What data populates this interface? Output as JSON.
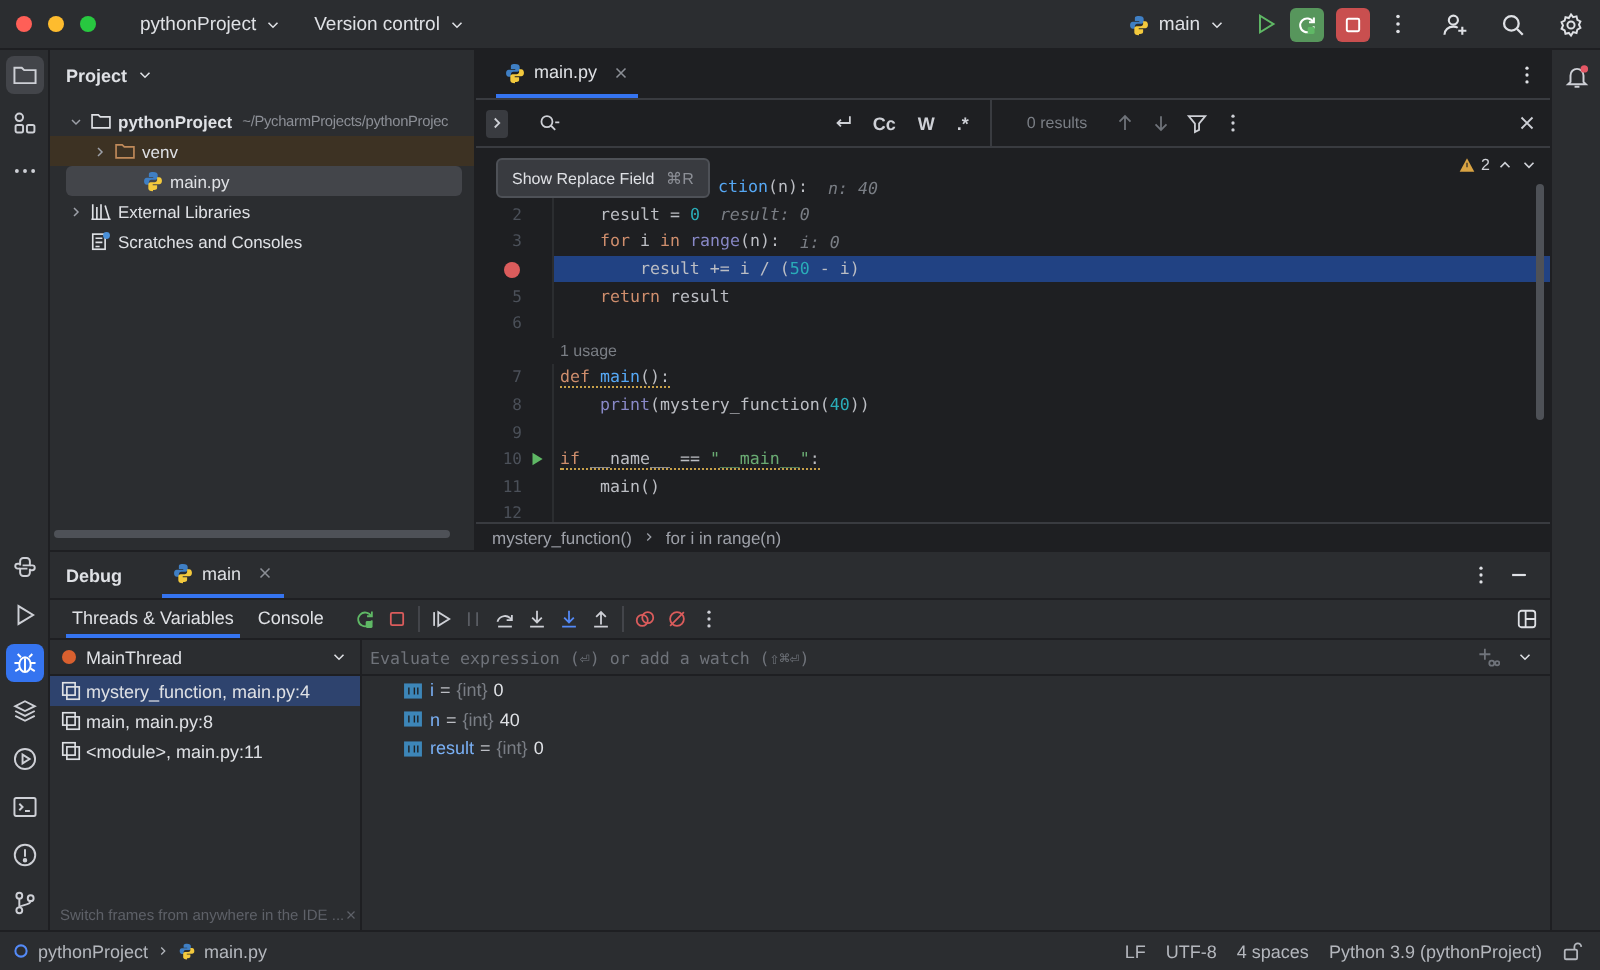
{
  "titlebar": {
    "project": "pythonProject",
    "vcs": "Version control",
    "run_config": "main"
  },
  "toolstrip": {
    "top": [
      {
        "selected": true
      },
      {
        "selected": false
      },
      {
        "selected": false
      }
    ],
    "bottom": [
      {
        "selected": false
      },
      {
        "selected": false
      },
      {
        "selected": true
      },
      {
        "selected": false
      },
      {
        "selected": false
      },
      {
        "selected": false
      },
      {
        "selected": false
      },
      {
        "selected": false
      }
    ]
  },
  "project_panel": {
    "title": "Project",
    "tree": [
      {
        "kind": "project",
        "name": "pythonProject",
        "path": "~/PycharmProjects/pythonProjec",
        "expanded": true,
        "selected": false,
        "excluded": false,
        "children": [
          {
            "kind": "folder",
            "name": "venv",
            "expanded": false,
            "selected": false,
            "excluded": true
          },
          {
            "kind": "python_file",
            "name": "main.py",
            "selected": true,
            "excluded": false
          }
        ]
      },
      {
        "kind": "library",
        "name": "External Libraries",
        "expanded": false,
        "selected": false,
        "excluded": false
      },
      {
        "kind": "scratches",
        "name": "Scratches and Consoles",
        "selected": false,
        "excluded": false
      }
    ]
  },
  "editor": {
    "tabs": [
      {
        "label": "main.py",
        "selected": true
      }
    ],
    "find": {
      "toggles": [
        "Cc",
        "W",
        ".*"
      ],
      "results": "0 results"
    },
    "tooltip": {
      "label": "Show Replace Field",
      "shortcut": "⌘R"
    },
    "warnings": "2",
    "lines": [
      {
        "kind": "partial",
        "current": false,
        "warning": false,
        "segments": [
          {
            "text": "ction",
            "kind": "fn"
          },
          {
            "text": "(n):",
            "kind": "plain"
          }
        ],
        "hint": "n: 40"
      },
      {
        "kind": "code",
        "number": "2",
        "breakpoint": false,
        "current": false,
        "run": false,
        "warning": false,
        "segments": [
          {
            "text": "    result = ",
            "kind": "plain"
          },
          {
            "text": "0",
            "kind": "num"
          }
        ],
        "hint": "result: 0"
      },
      {
        "kind": "code",
        "number": "3",
        "breakpoint": false,
        "current": false,
        "run": false,
        "warning": false,
        "segments": [
          {
            "text": "    for",
            "kind": "kw"
          },
          {
            "text": " i ",
            "kind": "plain"
          },
          {
            "text": "in ",
            "kind": "kw"
          },
          {
            "text": "range",
            "kind": "builtin"
          },
          {
            "text": "(n):",
            "kind": "plain"
          }
        ],
        "hint": "i: 0"
      },
      {
        "kind": "code",
        "breakpoint": true,
        "current": true,
        "run": false,
        "warning": false,
        "segments": [
          {
            "text": "        result += i / (",
            "kind": "plain"
          },
          {
            "text": "50",
            "kind": "num"
          },
          {
            "text": " - i)",
            "kind": "plain"
          }
        ]
      },
      {
        "kind": "code",
        "number": "5",
        "breakpoint": false,
        "current": false,
        "run": false,
        "warning": false,
        "segments": [
          {
            "text": "    return",
            "kind": "kw"
          },
          {
            "text": " result",
            "kind": "plain"
          }
        ]
      },
      {
        "kind": "code",
        "number": "6",
        "breakpoint": false,
        "current": false,
        "run": false
      },
      {
        "kind": "usage",
        "text": "1 usage"
      },
      {
        "kind": "code",
        "number": "7",
        "breakpoint": false,
        "current": false,
        "run": false,
        "warning": true,
        "segments": [
          {
            "text": "def ",
            "kind": "kw"
          },
          {
            "text": "main",
            "kind": "fn"
          },
          {
            "text": "():",
            "kind": "plain"
          }
        ]
      },
      {
        "kind": "code",
        "number": "8",
        "breakpoint": false,
        "current": false,
        "run": false,
        "warning": false,
        "segments": [
          {
            "text": "    print",
            "kind": "builtin"
          },
          {
            "text": "(mystery_function(",
            "kind": "plain"
          },
          {
            "text": "40",
            "kind": "num"
          },
          {
            "text": "))",
            "kind": "plain"
          }
        ]
      },
      {
        "kind": "code",
        "number": "9",
        "breakpoint": false,
        "current": false,
        "run": false
      },
      {
        "kind": "code",
        "number": "10",
        "breakpoint": false,
        "current": false,
        "run": true,
        "warning": true,
        "segments": [
          {
            "text": "if",
            "kind": "kw"
          },
          {
            "text": " __name__ == ",
            "kind": "plain"
          },
          {
            "text": "\"__main__\"",
            "kind": "str"
          },
          {
            "text": ":",
            "kind": "plain"
          }
        ]
      },
      {
        "kind": "code",
        "number": "11",
        "breakpoint": false,
        "current": false,
        "run": false,
        "warning": false,
        "segments": [
          {
            "text": "    main()",
            "kind": "plain"
          }
        ]
      },
      {
        "kind": "code",
        "number": "12",
        "breakpoint": false,
        "current": false,
        "run": false
      }
    ],
    "breadcrumbs": [
      "mystery_function()",
      "for i in range(n)"
    ]
  },
  "debug": {
    "title": "Debug",
    "tabs": [
      {
        "label": "main",
        "selected": true
      }
    ],
    "subtabs": [
      {
        "label": "Threads & Variables",
        "selected": true
      },
      {
        "label": "Console",
        "selected": false
      }
    ],
    "toolbar": [
      {
        "disabled": false
      },
      {
        "disabled": false
      },
      {
        "disabled": false
      },
      {
        "disabled": true
      },
      {
        "disabled": false
      },
      {
        "disabled": false
      },
      {
        "disabled": false
      },
      {
        "disabled": false
      },
      {
        "disabled": false
      },
      {
        "disabled": false
      },
      {
        "disabled": false
      }
    ],
    "thread": "MainThread",
    "frames": [
      {
        "label": "mystery_function, main.py:4",
        "selected": true
      },
      {
        "label": "main, main.py:8",
        "selected": false
      },
      {
        "label": "<module>, main.py:11",
        "selected": false
      }
    ],
    "frames_hint": "Switch frames from anywhere in the IDE ...",
    "watch_placeholder": "Evaluate expression (⏎) or add a watch (⇧⌘⏎)",
    "variables": [
      {
        "name": "i",
        "sign": "=",
        "type": "{int}",
        "value": "0"
      },
      {
        "name": "n",
        "sign": "=",
        "type": "{int}",
        "value": "40"
      },
      {
        "name": "result",
        "sign": "=",
        "type": "{int}",
        "value": "0"
      }
    ]
  },
  "status_bar": {
    "breadcrumb": [
      "pythonProject",
      "main.py"
    ],
    "items": [
      "LF",
      "UTF-8",
      "4 spaces",
      "Python 3.9 (pythonProject)"
    ]
  }
}
